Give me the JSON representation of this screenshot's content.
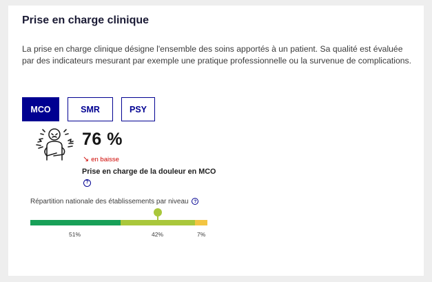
{
  "section": {
    "title": "Prise en charge clinique",
    "description": "La prise en charge clinique désigne l'ensemble des soins apportés à un patient. Sa qualité est évaluée par des indicateurs mesurant par exemple une pratique professionnelle ou la survenue de complications."
  },
  "tabs": [
    {
      "label": "MCO",
      "active": true
    },
    {
      "label": "SMR",
      "active": false
    },
    {
      "label": "PSY",
      "active": false
    }
  ],
  "indicator": {
    "icon": "person-in-pain-icon",
    "value": "76 %",
    "trend_icon": "arrow-down-right-icon",
    "trend_label": "en baisse",
    "name": "Prise en charge de la douleur en MCO",
    "help_icon": "question-circle-icon"
  },
  "distribution": {
    "label": "Répartition nationale des établissements par niveau",
    "segments": [
      {
        "percent_label": "51%",
        "value": 51,
        "color": "#18a058"
      },
      {
        "percent_label": "42%",
        "value": 42,
        "color": "#a9c73b"
      },
      {
        "percent_label": "7%",
        "value": 7,
        "color": "#f3c542"
      }
    ],
    "marker_segment": 1
  },
  "colors": {
    "accent": "#000091",
    "trend_down": "#ce0500"
  }
}
